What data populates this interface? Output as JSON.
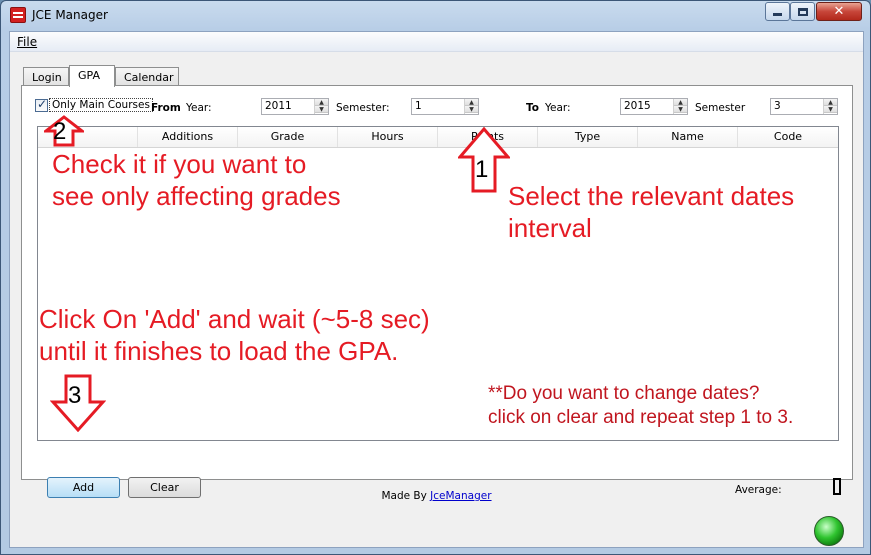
{
  "window": {
    "title": "JCE Manager"
  },
  "menu": {
    "file": "File"
  },
  "tabs": [
    {
      "label": "Login"
    },
    {
      "label": "GPA"
    },
    {
      "label": "Calendar"
    }
  ],
  "filters": {
    "only_main_label": "Only Main Courses",
    "only_main_checked": true,
    "from_label": "From",
    "to_label": "To",
    "year_label": "Year:",
    "semester_label": "Semester:",
    "semester_label_to": "Semester",
    "from_year": "2011",
    "from_semester": "1",
    "to_year": "2015",
    "to_semester": "3"
  },
  "grid": {
    "columns": [
      "",
      "Additions",
      "Grade",
      "Hours",
      "Points",
      "Type",
      "Name",
      "Code"
    ]
  },
  "buttons": {
    "add": "Add",
    "clear": "Clear"
  },
  "average": {
    "label": "Average:",
    "value": "0"
  },
  "footer": {
    "prefix": "Made By ",
    "link": "JceManager"
  },
  "annotations": {
    "num1": "1",
    "num2": "2",
    "num3": "3",
    "check_line1": "Check it if you want to",
    "check_line2": "see only affecting grades",
    "dates_line1": "Select the relevant dates",
    "dates_line2": "interval",
    "add_line1": "Click On 'Add' and wait (~5-8 sec)",
    "add_line2": "until it finishes to load the GPA.",
    "clear_line1": "**Do you want to change dates?",
    "clear_line2": "click on clear and repeat step 1 to 3.",
    "color": "#e51b24"
  }
}
